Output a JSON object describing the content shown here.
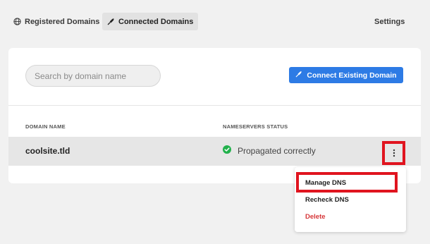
{
  "nav": {
    "registered_label": "Registered Domains",
    "connected_label": "Connected Domains",
    "settings_label": "Settings"
  },
  "toolbar": {
    "search_placeholder": "Search by domain name",
    "connect_label": "Connect Existing Domain"
  },
  "table": {
    "headers": [
      "DOMAIN NAME",
      "NAMESERVERS STATUS"
    ],
    "rows": [
      {
        "domain": "coolsite.tld",
        "status": "Propagated correctly"
      }
    ]
  },
  "menu": {
    "items": [
      "Manage DNS",
      "Recheck DNS",
      "Delete"
    ]
  },
  "colors": {
    "accent": "#2d7be5",
    "success": "#22b14c",
    "danger": "#d63638",
    "highlight": "#e0141f"
  }
}
